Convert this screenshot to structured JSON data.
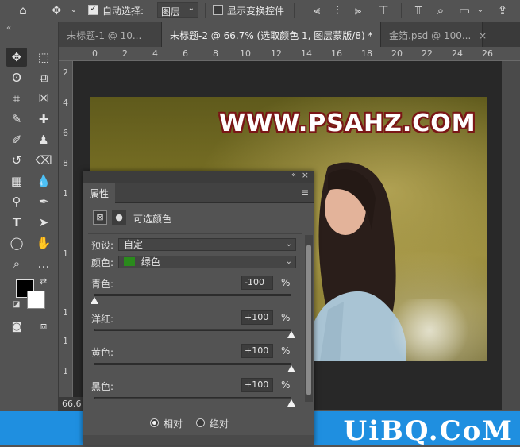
{
  "options_bar": {
    "auto_select_label": "自动选择:",
    "auto_select_checked": true,
    "auto_select_target": "图层",
    "show_transform_label": "显示变换控件",
    "show_transform_checked": false,
    "icons": [
      "home-icon",
      "move-icon",
      "align-icon",
      "search-icon",
      "workspace-icon",
      "share-icon"
    ]
  },
  "tabs": [
    {
      "label": "未标题-1 @ 10...",
      "active": false
    },
    {
      "label": "未标题-2 @ 66.7% (选取颜色 1, 图层蒙版/8) *",
      "active": true
    },
    {
      "label": "金箔.psd @ 100...",
      "active": false
    }
  ],
  "ruler_top": [
    "0",
    "2",
    "4",
    "6",
    "8",
    "10",
    "12",
    "14",
    "16",
    "18",
    "20",
    "22",
    "24",
    "26"
  ],
  "ruler_left": [
    "2",
    "4",
    "6",
    "8",
    "1",
    "1",
    "1",
    "1",
    "1"
  ],
  "canvas": {
    "watermark": "WWW.PSAHZ.COM"
  },
  "status": {
    "zoom": "66.6"
  },
  "corner_watermark": "UiBQ.CoM",
  "properties_panel": {
    "tab_label": "属性",
    "adjustment_title": "可选颜色",
    "preset_label": "预设:",
    "preset_value": "自定",
    "color_label": "颜色:",
    "color_value": "绿色",
    "color_swatch": "#2a8a1c",
    "sliders": [
      {
        "label": "青色:",
        "value": "-100",
        "unit": "%",
        "level": 0.0
      },
      {
        "label": "洋红:",
        "value": "+100",
        "unit": "%",
        "level": 1.0
      },
      {
        "label": "黄色:",
        "value": "+100",
        "unit": "%",
        "level": 1.0
      },
      {
        "label": "黑色:",
        "value": "+100",
        "unit": "%",
        "level": 1.0
      }
    ],
    "method_relative": "相对",
    "method_absolute": "绝对",
    "method_selected": "relative"
  }
}
